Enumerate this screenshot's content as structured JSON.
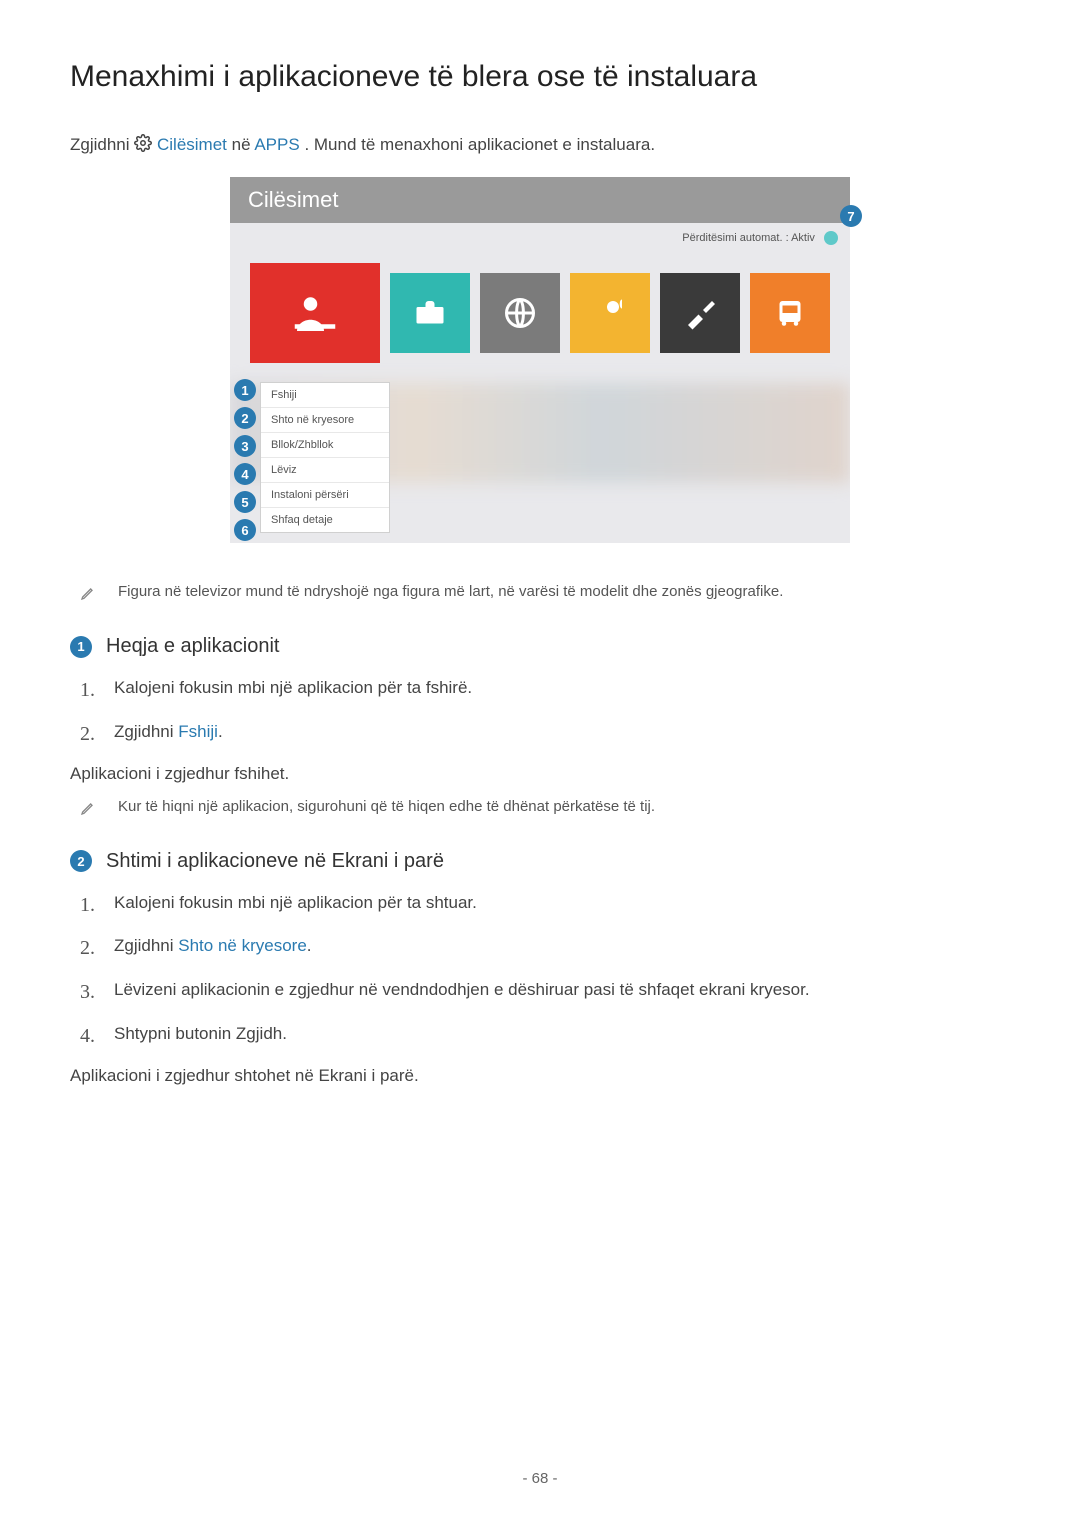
{
  "title": "Menaxhimi i aplikacioneve të blera ose të instaluara",
  "intro": {
    "pre": "Zgjidhni ",
    "link1": "Cilësimet",
    "mid": " në ",
    "link2": "APPS",
    "post": ". Mund të menaxhoni aplikacionet e instaluara."
  },
  "figure": {
    "header": "Cilësimet",
    "auto_update": "Përditësimi automat. : Aktiv",
    "context_menu": [
      "Fshiji",
      "Shto në kryesore",
      "Bllok/Zhbllok",
      "Lëviz",
      "Instaloni përsëri",
      "Shfaq detaje"
    ],
    "badges": [
      "1",
      "2",
      "3",
      "4",
      "5",
      "6",
      "7"
    ]
  },
  "note_figure": "Figura në televizor mund të ndryshojë nga figura më lart, në varësi të modelit dhe zonës gjeografike.",
  "section1": {
    "num": "1",
    "title": "Heqja e aplikacionit",
    "steps": [
      {
        "pre": "Kalojeni fokusin mbi një aplikacion për ta fshirë."
      },
      {
        "pre": "Zgjidhni ",
        "link": "Fshiji",
        "post": "."
      }
    ],
    "result": "Aplikacioni i zgjedhur fshihet.",
    "note": "Kur të hiqni një aplikacion, sigurohuni që të hiqen edhe të dhënat përkatëse të tij."
  },
  "section2": {
    "num": "2",
    "title": "Shtimi i aplikacioneve në Ekrani i parë",
    "steps": [
      {
        "pre": "Kalojeni fokusin mbi një aplikacion për ta shtuar."
      },
      {
        "pre": "Zgjidhni ",
        "link": "Shto në kryesore",
        "post": "."
      },
      {
        "pre": "Lëvizeni aplikacionin e zgjedhur në vendndodhjen e dëshiruar pasi të shfaqet ekrani kryesor."
      },
      {
        "pre": "Shtypni butonin Zgjidh."
      }
    ],
    "result": "Aplikacioni i zgjedhur shtohet në Ekrani i parë."
  },
  "page_number": "- 68 -"
}
